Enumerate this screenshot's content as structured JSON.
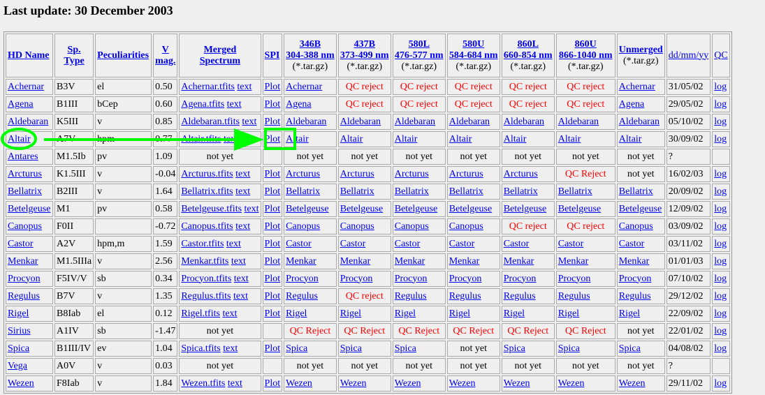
{
  "title": "Last update: 30 December 2003",
  "headers": [
    {
      "lines": [
        "HD Name"
      ]
    },
    {
      "lines": [
        "Sp.",
        "Type"
      ]
    },
    {
      "lines": [
        "Peculiarities"
      ]
    },
    {
      "lines": [
        "V",
        "mag."
      ]
    },
    {
      "lines": [
        "Merged",
        "Spectrum"
      ]
    },
    {
      "lines": [
        "SPI"
      ]
    },
    {
      "lines": [
        "346B",
        "304-388 nm"
      ],
      "sub": "(*.tar.gz)"
    },
    {
      "lines": [
        "437B",
        "373-499 nm"
      ],
      "sub": "(*.tar.gz)"
    },
    {
      "lines": [
        "580L",
        "476-577 nm"
      ],
      "sub": "(*.tar.gz)"
    },
    {
      "lines": [
        "580U",
        "584-684 nm"
      ],
      "sub": "(*.tar.gz)"
    },
    {
      "lines": [
        "860L",
        "660-854 nm"
      ],
      "sub": "(*.tar.gz)"
    },
    {
      "lines": [
        "860U",
        "866-1040 nm"
      ],
      "sub": "(*.tar.gz)"
    },
    {
      "lines": [
        "Unmerged"
      ],
      "sub": "(*.tar.gz)"
    },
    {
      "lines": [
        "dd/mm/yy"
      ],
      "plain": true
    },
    {
      "lines": [
        "QC"
      ],
      "plain": true
    }
  ],
  "labels": {
    "not_yet": "not yet",
    "text_link": "text",
    "plot_link": "Plot",
    "log_link": "log"
  },
  "colors": {
    "link": "#0000ee",
    "reject": "#ff0000",
    "annotation": "#00ff00"
  },
  "rows": [
    {
      "name": "Achernar",
      "sp": "B3V",
      "pec": "el",
      "vmag": "0.50",
      "merged": "Achernar.tfits",
      "spi": true,
      "bands": [
        "Achernar",
        "QC reject",
        "QC reject",
        "QC reject",
        "QC reject",
        "QC reject"
      ],
      "unmerged": "Achernar",
      "date": "31/05/02",
      "log": true
    },
    {
      "name": "Agena",
      "sp": "B1III",
      "pec": "bCep",
      "vmag": "0.60",
      "merged": "Agena.tfits",
      "spi": true,
      "bands": [
        "Agena",
        "QC reject",
        "QC reject",
        "QC reject",
        "QC reject",
        "QC reject"
      ],
      "unmerged": "Agena",
      "date": "29/05/02",
      "log": true
    },
    {
      "name": "Aldebaran",
      "sp": "K5III",
      "pec": "v",
      "vmag": "0.85",
      "merged": "Aldebaran.tfits",
      "spi": true,
      "bands": [
        "Aldebaran",
        "Aldebaran",
        "Aldebaran",
        "Aldebaran",
        "Aldebaran",
        "Aldebaran"
      ],
      "unmerged": "Aldebaran",
      "date": "05/10/02",
      "log": true
    },
    {
      "name": "Altair",
      "sp": "A7V",
      "pec": "hpm",
      "vmag": "0.77",
      "merged": "Altair.tfits",
      "spi": true,
      "bands": [
        "Altair",
        "Altair",
        "Altair",
        "Altair",
        "Altair",
        "Altair"
      ],
      "unmerged": "Altair",
      "date": "30/09/02",
      "log": true
    },
    {
      "name": "Antares",
      "sp": "M1.5Ib",
      "pec": "pv",
      "vmag": "1.09",
      "merged": null,
      "spi": false,
      "bands": [
        "not yet",
        "not yet",
        "not yet",
        "not yet",
        "not yet",
        "not yet"
      ],
      "unmerged": "not yet",
      "date": "?",
      "log": false
    },
    {
      "name": "Arcturus",
      "sp": "K1.5III",
      "pec": "v",
      "vmag": "-0.04",
      "merged": "Arcturus.tfits",
      "spi": true,
      "bands": [
        "Arcturus",
        "Arcturus",
        "Arcturus",
        "Arcturus",
        "Arcturus",
        "QC Reject"
      ],
      "unmerged": "not yet",
      "date": "16/02/03",
      "log": true
    },
    {
      "name": "Bellatrix",
      "sp": "B2III",
      "pec": "v",
      "vmag": "1.64",
      "merged": "Bellatrix.tfits",
      "spi": true,
      "bands": [
        "Bellatrix",
        "Bellatrix",
        "Bellatrix",
        "Bellatrix",
        "Bellatrix",
        "Bellatrix"
      ],
      "unmerged": "Bellatrix",
      "date": "20/09/02",
      "log": true
    },
    {
      "name": "Betelgeuse",
      "sp": "M1",
      "pec": "pv",
      "vmag": "0.58",
      "merged": "Betelgeuse.tfits",
      "spi": true,
      "bands": [
        "Betelgeuse",
        "Betelgeuse",
        "Betelgeuse",
        "Betelgeuse",
        "Betelgeuse",
        "Betelgeuse"
      ],
      "unmerged": "Betelgeuse",
      "date": "12/09/02",
      "log": true
    },
    {
      "name": "Canopus",
      "sp": "F0II",
      "pec": "",
      "vmag": "-0.72",
      "merged": "Canopus.tfits",
      "spi": true,
      "bands": [
        "Canopus",
        "Canopus",
        "Canopus",
        "Canopus",
        "QC reject",
        "QC reject"
      ],
      "unmerged": "Canopus",
      "date": "03/09/02",
      "log": true
    },
    {
      "name": "Castor",
      "sp": "A2V",
      "pec": "hpm,m",
      "vmag": "1.59",
      "merged": "Castor.tfits",
      "spi": true,
      "bands": [
        "Castor",
        "Castor",
        "Castor",
        "Castor",
        "Castor",
        "Castor"
      ],
      "unmerged": "Castor",
      "date": "03/11/02",
      "log": true
    },
    {
      "name": "Menkar",
      "sp": "M1.5IIIa",
      "pec": "v",
      "vmag": "2.56",
      "merged": "Menkar.tfits",
      "spi": true,
      "bands": [
        "Menkar",
        "Menkar",
        "Menkar",
        "Menkar",
        "Menkar",
        "Menkar"
      ],
      "unmerged": "Menkar",
      "date": "01/01/03",
      "log": true
    },
    {
      "name": "Procyon",
      "sp": "F5IV/V",
      "pec": "sb",
      "vmag": "0.34",
      "merged": "Procyon.tfits",
      "spi": true,
      "bands": [
        "Procyon",
        "Procyon",
        "Procyon",
        "Procyon",
        "Procyon",
        "Procyon"
      ],
      "unmerged": "Procyon",
      "date": "07/10/02",
      "log": true
    },
    {
      "name": "Regulus",
      "sp": "B7V",
      "pec": "v",
      "vmag": "1.35",
      "merged": "Regulus.tfits",
      "spi": true,
      "bands": [
        "Regulus",
        "QC reject",
        "Regulus",
        "Regulus",
        "Regulus",
        "Regulus"
      ],
      "unmerged": "Regulus",
      "date": "29/12/02",
      "log": true
    },
    {
      "name": "Rigel",
      "sp": "B8Iab",
      "pec": "el",
      "vmag": "0.12",
      "merged": "Rigel.tfits",
      "spi": true,
      "bands": [
        "Rigel",
        "Rigel",
        "Rigel",
        "Rigel",
        "Rigel",
        "Rigel"
      ],
      "unmerged": "Rigel",
      "date": "22/09/02",
      "log": true
    },
    {
      "name": "Sirius",
      "sp": "A1IV",
      "pec": "sb",
      "vmag": "-1.47",
      "merged": null,
      "spi": false,
      "bands": [
        "QC Reject",
        "QC Reject",
        "QC Reject",
        "QC Reject",
        "QC Reject",
        "QC Reject"
      ],
      "unmerged": "not yet",
      "date": "22/01/02",
      "log": true
    },
    {
      "name": "Spica",
      "sp": "B1III/IV",
      "pec": "ev",
      "vmag": "1.04",
      "merged": "Spica.tfits",
      "spi": true,
      "bands": [
        "Spica",
        "Spica",
        "Spica",
        "not yet",
        "Spica",
        "Spica"
      ],
      "unmerged": "Spica",
      "date": "04/08/02",
      "log": true
    },
    {
      "name": "Vega",
      "sp": "A0V",
      "pec": "v",
      "vmag": "0.03",
      "merged": null,
      "spi": false,
      "bands": [
        "not yet",
        "not yet",
        "not yet",
        "not yet",
        "not yet",
        "not yet"
      ],
      "unmerged": "not yet",
      "date": "?",
      "log": false
    },
    {
      "name": "Wezen",
      "sp": "F8Iab",
      "pec": "v",
      "vmag": "1.84",
      "merged": "Wezen.tfits",
      "spi": true,
      "bands": [
        "Wezen",
        "Wezen",
        "Wezen",
        "Wezen",
        "Wezen",
        "Wezen"
      ],
      "unmerged": "Wezen",
      "date": "29/11/02",
      "log": true
    }
  ]
}
